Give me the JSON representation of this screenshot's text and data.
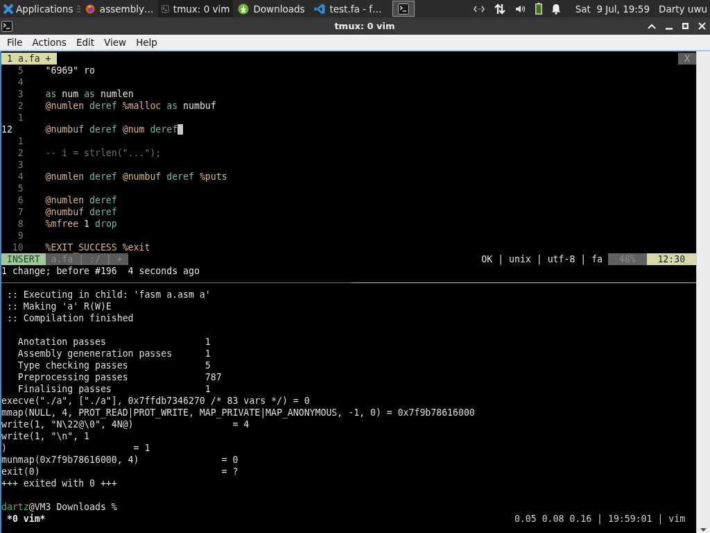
{
  "taskbar": {
    "apps_label": "Applications",
    "tasks": [
      {
        "label": "assembly…",
        "kind": "browser",
        "selected": false
      },
      {
        "label": "tmux: 0 vim",
        "kind": "terminal",
        "selected": true
      },
      {
        "label": "Downloads",
        "kind": "download",
        "selected": false
      },
      {
        "label": "test.fa - f…",
        "kind": "editor",
        "selected": false
      }
    ],
    "clock": "Sat  9 Jul, 19:59",
    "user": "Darty uwu"
  },
  "window": {
    "title": "tmux: 0 vim"
  },
  "menu": [
    "File",
    "Actions",
    "Edit",
    "View",
    "Help"
  ],
  "vim": {
    "tab": "1 a.fa +",
    "close": "X",
    "lines": [
      {
        "number": "5",
        "current": false,
        "tokens": [
          {
            "text": "\"6969\"",
            "kind": "string"
          },
          {
            "text": "ro",
            "kind": "ident"
          }
        ]
      },
      {
        "number": "4",
        "current": false
      },
      {
        "number": "3",
        "current": false,
        "tokens": [
          {
            "text": "as",
            "kind": "keyword"
          },
          {
            "text": "num",
            "kind": "ident"
          },
          {
            "text": "as",
            "kind": "keyword"
          },
          {
            "text": "numlen",
            "kind": "ident"
          }
        ]
      },
      {
        "number": "2",
        "current": false,
        "tokens": [
          {
            "text": "@numlen",
            "kind": "ref"
          },
          {
            "text": "deref",
            "kind": "keyword"
          },
          {
            "text": "%malloc",
            "kind": "builtin"
          },
          {
            "text": "as",
            "kind": "keyword"
          },
          {
            "text": "numbuf",
            "kind": "ident"
          }
        ]
      },
      {
        "number": "1",
        "current": false
      },
      {
        "number": "12",
        "current": true,
        "tokens": [
          {
            "text": "@numbuf",
            "kind": "ref"
          },
          {
            "text": "deref",
            "kind": "keyword"
          },
          {
            "text": "@num",
            "kind": "ref"
          },
          {
            "text": "deref",
            "kind": "keyword"
          }
        ]
      },
      {
        "number": "1",
        "current": false
      },
      {
        "number": "2",
        "current": false,
        "tokens": [
          {
            "text": "-- i = strlen(\"...\");",
            "kind": "comment"
          }
        ]
      },
      {
        "number": "3",
        "current": false
      },
      {
        "number": "4",
        "current": false,
        "tokens": [
          {
            "text": "@numlen",
            "kind": "ref"
          },
          {
            "text": "deref",
            "kind": "keyword"
          },
          {
            "text": "@numbuf",
            "kind": "ref"
          },
          {
            "text": "deref",
            "kind": "keyword"
          },
          {
            "text": "%puts",
            "kind": "builtin"
          }
        ]
      },
      {
        "number": "5",
        "current": false
      },
      {
        "number": "6",
        "current": false,
        "tokens": [
          {
            "text": "@numlen",
            "kind": "ref"
          },
          {
            "text": "deref",
            "kind": "keyword"
          }
        ]
      },
      {
        "number": "7",
        "current": false,
        "tokens": [
          {
            "text": "@numbuf",
            "kind": "ref"
          },
          {
            "text": "deref",
            "kind": "keyword"
          }
        ]
      },
      {
        "number": "8",
        "current": false,
        "tokens": [
          {
            "text": "%mfree",
            "kind": "builtin"
          },
          {
            "text": "1",
            "kind": "ident"
          },
          {
            "text": "drop",
            "kind": "keyword"
          }
        ]
      },
      {
        "number": "9",
        "current": false
      },
      {
        "number": "10",
        "current": false,
        "tokens": [
          {
            "text": "%EXIT_SUCCESS",
            "kind": "builtin"
          },
          {
            "text": "%exit",
            "kind": "builtin"
          }
        ]
      }
    ],
    "mode": "INSERT",
    "file_section": "a.fa | :/ | +",
    "status_right": "OK | unix | utf-8 | fa",
    "percent": "48%",
    "position": "12:30",
    "message": "1 change; before #196  4 seconds ago"
  },
  "output": {
    "log": [
      ":: Executing in child: 'fasm a.asm a'",
      ":: Making 'a' R(W)E",
      ":: Compilation finished"
    ],
    "passes": [
      {
        "label": "Anotation passes",
        "value": "1"
      },
      {
        "label": "Assembly geneneration passes",
        "value": "1"
      },
      {
        "label": "Type checking passes",
        "value": "5"
      },
      {
        "label": "Preprocessing passes",
        "value": "787"
      },
      {
        "label": "Finalising passes",
        "value": "1"
      }
    ],
    "trace": [
      "execve(\"./a\", [\"./a\"], 0x7ffdb7346270 /* 83 vars */) = 0",
      "mmap(NULL, 4, PROT_READ|PROT_WRITE, MAP_PRIVATE|MAP_ANONYMOUS, -1, 0) = 0x7f9b78616000",
      "write(1, \"N\\22@\\0\", 4N@)                  = 4",
      "write(1, \"\\n\", 1",
      ")                       = 1",
      "munmap(0x7f9b78616000, 4)               = 0",
      "exit(0)                                 = ?",
      "+++ exited with 0 +++"
    ],
    "prompt_user": "dartz",
    "prompt_rest": "@VM3 Downloads %"
  },
  "tmux": {
    "window": "*0 vim*",
    "status": "0.05 0.08 0.16 | 19:59:01 | vim"
  }
}
